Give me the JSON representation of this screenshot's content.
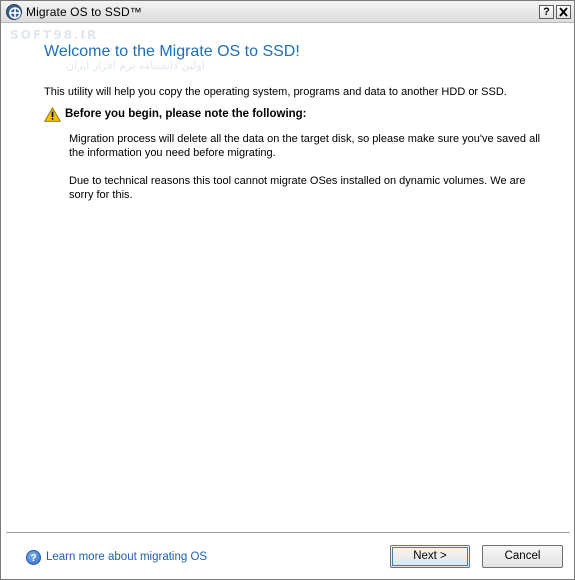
{
  "window": {
    "title": "Migrate OS to SSD™",
    "help_button": "?",
    "close_button": "X"
  },
  "watermark": {
    "line1": "SOFT98.IR",
    "line2": "اولین دانشنامه نرم افزار ایران",
    "line3": ""
  },
  "content": {
    "heading": "Welcome to the Migrate OS to SSD!",
    "intro": "This utility will help you copy the operating system, programs and data to another HDD or SSD.",
    "warning_heading": "Before you begin, please note the following:",
    "note1": "Migration process will delete all the data on the target disk, so please make sure you've saved all the information you need before migrating.",
    "note2": "Due to technical reasons this tool cannot migrate OSes installed on dynamic volumes. We are sorry for this."
  },
  "footer": {
    "help_link": "Learn more about migrating OS",
    "next_label": "Next >",
    "cancel_label": "Cancel"
  },
  "colors": {
    "heading": "#1f6fb5",
    "link": "#1f5fa8",
    "warning": "#f2c200"
  },
  "icons": [
    "app-icon",
    "warning-icon",
    "help-icon"
  ]
}
